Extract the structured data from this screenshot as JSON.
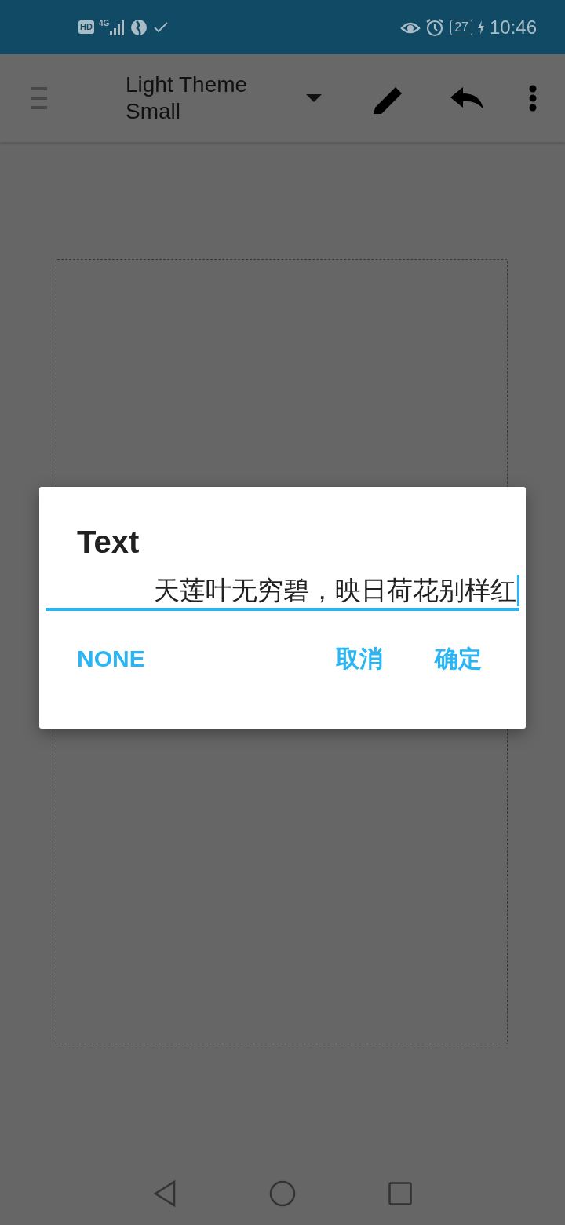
{
  "status_bar": {
    "hd": "HD",
    "network": "4G",
    "battery": "27",
    "time": "10:46"
  },
  "toolbar": {
    "title": "Light Theme",
    "subtitle": "Small"
  },
  "dialog": {
    "title": "Text",
    "value": "天莲叶无穷碧，映日荷花别样红",
    "buttons": [
      {
        "label": "NONE"
      },
      {
        "label": "取消"
      },
      {
        "label": "确定"
      }
    ]
  }
}
